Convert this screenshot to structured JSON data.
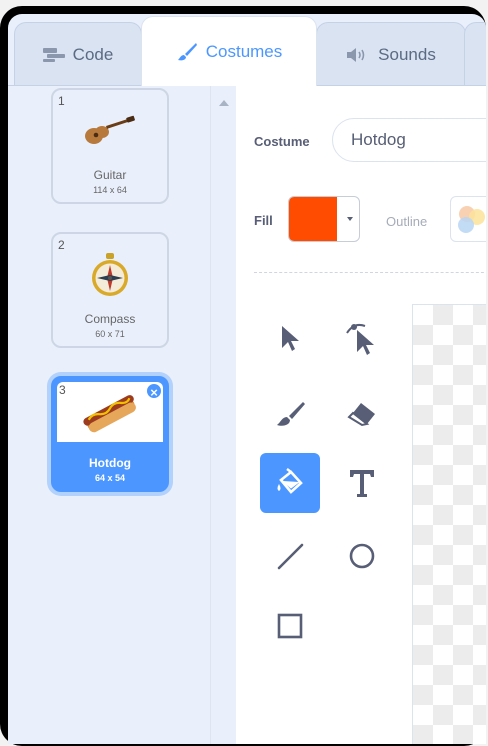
{
  "tabs": [
    {
      "label": "Code",
      "icon": "code-blocks-icon"
    },
    {
      "label": "Costumes",
      "icon": "brush-icon"
    },
    {
      "label": "Sounds",
      "icon": "speaker-icon"
    }
  ],
  "costumes": [
    {
      "number": "1",
      "name": "Guitar",
      "size": "114 x 64",
      "icon": "guitar-icon"
    },
    {
      "number": "2",
      "name": "Compass",
      "size": "60 x 71",
      "icon": "compass-icon"
    },
    {
      "number": "3",
      "name": "Hotdog",
      "size": "64 x 54",
      "icon": "hotdog-icon",
      "selected": true
    }
  ],
  "editor": {
    "costume_label": "Costume",
    "costume_name": "Hotdog",
    "fill_label": "Fill",
    "fill_color": "#ff4c00",
    "outline_label": "Outline"
  },
  "tools": [
    {
      "name": "select-tool",
      "icon": "arrow-cursor-icon"
    },
    {
      "name": "reshape-tool",
      "icon": "reshape-cursor-icon"
    },
    {
      "name": "brush-tool",
      "icon": "brush-icon"
    },
    {
      "name": "eraser-tool",
      "icon": "eraser-icon"
    },
    {
      "name": "fill-tool",
      "icon": "paint-bucket-icon",
      "active": true
    },
    {
      "name": "text-tool",
      "icon": "text-t-icon"
    },
    {
      "name": "line-tool",
      "icon": "line-icon"
    },
    {
      "name": "circle-tool",
      "icon": "circle-icon"
    },
    {
      "name": "rectangle-tool",
      "icon": "square-icon"
    }
  ],
  "colors": {
    "accent": "#4c97ff",
    "sidebar_bg": "#e9f0fb",
    "tool_icon": "#575e75"
  }
}
